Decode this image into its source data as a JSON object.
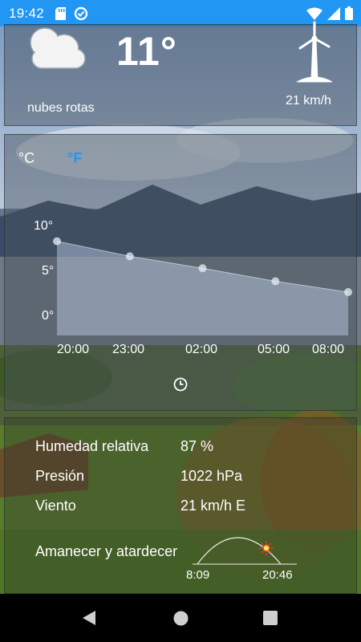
{
  "status_bar": {
    "time": "19:42",
    "left_icons": [
      "sd-card-icon",
      "data-saver-icon"
    ],
    "right_icons": [
      "wifi-icon",
      "signal-icon",
      "battery-icon"
    ],
    "color": "#2196f3"
  },
  "current": {
    "temperature": "11°",
    "description": "nubes rotas",
    "wind_speed": "21 km/h",
    "weather_icon": "cloud-icon",
    "wind_icon": "wind-turbine-icon"
  },
  "units": {
    "celsius": "°C",
    "fahrenheit": "°F",
    "selected_color": "#2196f3"
  },
  "chart_data": {
    "type": "area",
    "x": [
      "20:00",
      "23:00",
      "02:00",
      "05:00",
      "08:00"
    ],
    "y_ticks": [
      "10°",
      "5°",
      "0°"
    ],
    "ylim": [
      0,
      10
    ],
    "values": [
      8.7,
      7.3,
      6.2,
      5.0,
      4.0
    ],
    "fill_color": "#c8dcf5",
    "grid": false
  },
  "details": {
    "humidity_label": "Humedad relativa",
    "humidity_value": "87 %",
    "pressure_label": "Presión",
    "pressure_value": "1022 hPa",
    "wind_label": "Viento",
    "wind_value": "21 km/h E",
    "sun_label": "Amanecer y atardecer",
    "sunrise": "8:09",
    "sunset": "20:46"
  },
  "nav": {
    "icons": [
      "back-icon",
      "home-icon",
      "recents-icon"
    ]
  }
}
